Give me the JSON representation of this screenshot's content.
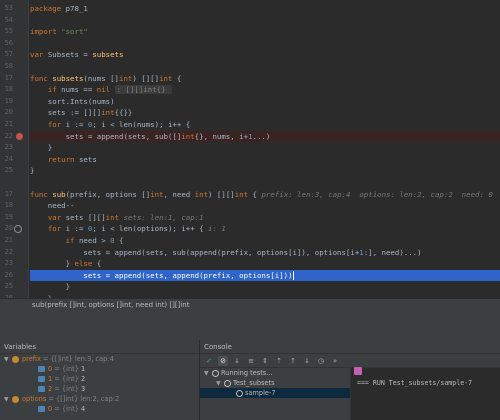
{
  "editor": {
    "lines": [
      {
        "n": "53",
        "segs": [
          [
            "kw",
            "package "
          ],
          [
            "id",
            "p78_1"
          ]
        ]
      },
      {
        "n": "54",
        "segs": []
      },
      {
        "n": "55",
        "segs": [
          [
            "kw",
            "import "
          ],
          [
            "str",
            "\"sort\""
          ]
        ]
      },
      {
        "n": "56",
        "segs": []
      },
      {
        "n": "57",
        "segs": [
          [
            "kw",
            "var "
          ],
          [
            "id",
            "Subsets = "
          ],
          [
            "fn",
            "subsets"
          ]
        ]
      },
      {
        "n": "58",
        "segs": []
      },
      {
        "n": "17",
        "segs": [
          [
            "kw",
            "func "
          ],
          [
            "fn",
            "subsets"
          ],
          [
            "id",
            "(nums []"
          ],
          [
            "kw",
            "int"
          ],
          [
            "id",
            ") [][]"
          ],
          [
            "kw",
            "int"
          ],
          [
            "id",
            " {"
          ]
        ]
      },
      {
        "n": "18",
        "segs": [
          [
            "id",
            "    "
          ],
          [
            "kw",
            "if "
          ],
          [
            "id",
            "nums == "
          ],
          [
            "kw",
            "nil "
          ],
          [
            "hintbox",
            ": [][]int{} "
          ]
        ]
      },
      {
        "n": "19",
        "segs": [
          [
            "id",
            "    sort.Ints(nums)"
          ]
        ]
      },
      {
        "n": "20",
        "segs": [
          [
            "id",
            "    sets := [][]"
          ],
          [
            "kw",
            "int"
          ],
          [
            "id",
            "{{}}"
          ]
        ]
      },
      {
        "n": "21",
        "segs": [
          [
            "id",
            "    "
          ],
          [
            "kw",
            "for "
          ],
          [
            "id",
            "i := "
          ],
          [
            "num",
            "0"
          ],
          [
            "id",
            "; i < len(nums); i++ {"
          ]
        ]
      },
      {
        "n": "22",
        "segs": [
          [
            "id",
            "        sets = append(sets, sub([]"
          ],
          [
            "kw",
            "int"
          ],
          [
            "id",
            "{}, nums, i+"
          ],
          [
            "num",
            "1"
          ],
          [
            "id",
            "...)"
          ]
        ]
      },
      {
        "n": "23",
        "segs": [
          [
            "id",
            "    }"
          ]
        ]
      },
      {
        "n": "24",
        "segs": [
          [
            "id",
            "    "
          ],
          [
            "kw",
            "return "
          ],
          [
            "id",
            "sets"
          ]
        ]
      },
      {
        "n": "25",
        "segs": [
          [
            "id",
            "}"
          ]
        ]
      },
      {
        "n": "",
        "segs": []
      },
      {
        "n": "17",
        "segs": [
          [
            "kw",
            "func "
          ],
          [
            "fn",
            "sub"
          ],
          [
            "id",
            "(prefix, options []"
          ],
          [
            "kw",
            "int"
          ],
          [
            "id",
            ", need "
          ],
          [
            "kw",
            "int"
          ],
          [
            "id",
            ") [][]"
          ],
          [
            "kw",
            "int "
          ],
          [
            "id",
            "{ "
          ],
          [
            "hint",
            "prefix: len:3, cap:4  options: len:2, cap:2  need: 0"
          ]
        ]
      },
      {
        "n": "18",
        "segs": [
          [
            "id",
            "    need--"
          ]
        ]
      },
      {
        "n": "19",
        "segs": [
          [
            "id",
            "    "
          ],
          [
            "kw",
            "var "
          ],
          [
            "id",
            "sets [][]"
          ],
          [
            "kw",
            "int "
          ],
          [
            "hint",
            "sets: len:1, cap:1"
          ]
        ]
      },
      {
        "n": "20",
        "segs": [
          [
            "id",
            "    "
          ],
          [
            "kw",
            "for "
          ],
          [
            "id",
            "i := "
          ],
          [
            "num",
            "0"
          ],
          [
            "id",
            "; i < len(options); i++ { "
          ],
          [
            "hint",
            "i: 1"
          ]
        ]
      },
      {
        "n": "21",
        "segs": [
          [
            "id",
            "        "
          ],
          [
            "kw",
            "if "
          ],
          [
            "id",
            "need > "
          ],
          [
            "num",
            "0"
          ],
          [
            "id",
            " {"
          ]
        ]
      },
      {
        "n": "22",
        "segs": [
          [
            "id",
            "            sets = append(sets, sub(append(prefix, options[i]), options[i+"
          ],
          [
            "num",
            "1"
          ],
          [
            "id",
            ":], need)...)"
          ]
        ]
      },
      {
        "n": "23",
        "segs": [
          [
            "id",
            "        } "
          ],
          [
            "kw",
            "else "
          ],
          [
            "id",
            "{"
          ]
        ]
      },
      {
        "n": "26",
        "segs": [
          [
            "id",
            "            sets = "
          ],
          [
            "fn",
            "append"
          ],
          [
            "id",
            "(sets, "
          ],
          [
            "fn",
            "append"
          ],
          [
            "id",
            "(prefix, options[i]))"
          ]
        ]
      },
      {
        "n": "25",
        "segs": [
          [
            "id",
            "        }"
          ]
        ]
      },
      {
        "n": "26",
        "segs": [
          [
            "id",
            "    }"
          ]
        ]
      },
      {
        "n": "27",
        "segs": [
          [
            "id",
            "    "
          ],
          [
            "kw",
            "return "
          ],
          [
            "id",
            "sets"
          ]
        ]
      },
      {
        "n": "28",
        "segs": [
          [
            "id",
            "}"
          ]
        ]
      }
    ]
  },
  "signature": "sub(prefix []int, options []int, need int) [][]int",
  "variables": {
    "title": "Variables",
    "rows": [
      {
        "indent": 0,
        "expanded": true,
        "icon": "obj",
        "name": "prefix",
        "type": " = {[]int} len:3, cap:4",
        "value": ""
      },
      {
        "indent": 1,
        "icon": "fld",
        "name": "0",
        "type": " = {int} ",
        "value": "1"
      },
      {
        "indent": 1,
        "icon": "fld",
        "name": "1",
        "type": " = {int} ",
        "value": "2"
      },
      {
        "indent": 1,
        "icon": "fld",
        "name": "2",
        "type": " = {int} ",
        "value": "3"
      },
      {
        "indent": 0,
        "expanded": true,
        "icon": "obj",
        "name": "options",
        "type": " = {[]int} len:2, cap:2",
        "value": ""
      },
      {
        "indent": 1,
        "icon": "fld",
        "name": "0",
        "type": " = {int} ",
        "value": "4"
      }
    ]
  },
  "console": {
    "title": "Console",
    "tree": [
      {
        "indent": 0,
        "label": "Running tests..."
      },
      {
        "indent": 1,
        "label": "Test_subsets"
      },
      {
        "indent": 2,
        "label": "sample-7",
        "selected": true
      }
    ],
    "output": "=== RUN   Test_subsets/sample-7"
  }
}
